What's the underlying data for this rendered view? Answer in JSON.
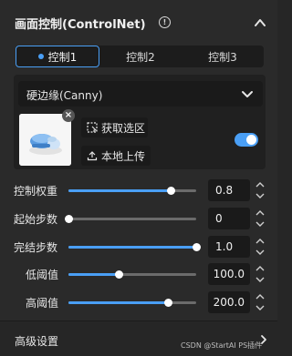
{
  "header": {
    "title": "画面控制(ControlNet)",
    "info_icon": "info-circle-icon",
    "collapse_icon": "chevron-up-icon"
  },
  "tabs": [
    {
      "label": "控制1",
      "active": true
    },
    {
      "label": "控制2",
      "active": false
    },
    {
      "label": "控制3",
      "active": false
    }
  ],
  "model_select": {
    "value": "硬边缘(Canny)",
    "icon": "chevron-down-icon"
  },
  "image": {
    "close_icon": "close-icon",
    "pick_region_label": "获取选区",
    "pick_region_icon": "selection-icon",
    "upload_label": "本地上传",
    "upload_icon": "upload-icon",
    "enabled": true
  },
  "params": [
    {
      "label": "控制权重",
      "value": "0.8",
      "fraction": 0.8
    },
    {
      "label": "起始步数",
      "value": "0",
      "fraction": 0.0
    },
    {
      "label": "完结步数",
      "value": "1.0",
      "fraction": 1.0
    },
    {
      "label": "低阈值",
      "value": "100.0",
      "fraction": 0.39
    },
    {
      "label": "高阈值",
      "value": "200.0",
      "fraction": 0.78
    }
  ],
  "footer": {
    "title": "高级设置",
    "icon": "chevron-right-icon"
  },
  "watermark": "CSDN @StartAI PS插件",
  "colors": {
    "accent": "#4a9ff5",
    "panel_bg": "#2a2a2a",
    "input_bg": "#1a1a1a"
  }
}
